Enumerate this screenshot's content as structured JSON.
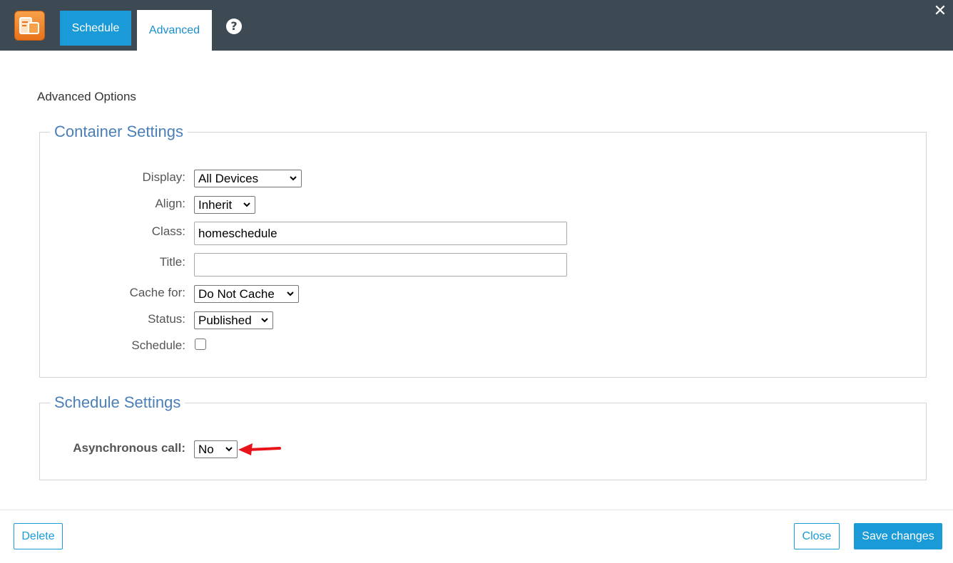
{
  "tabs": {
    "schedule": "Schedule",
    "advanced": "Advanced"
  },
  "icons": {
    "logo": "module-logo-icon",
    "help": "question-circle-icon",
    "close": "close-icon",
    "annotation": "red-arrow-icon"
  },
  "help_glyph": "?",
  "close_glyph": "✕",
  "heading": "Advanced Options",
  "container_settings": {
    "legend": "Container Settings",
    "display": {
      "label": "Display:",
      "value": "All Devices"
    },
    "align": {
      "label": "Align:",
      "value": "Inherit"
    },
    "class": {
      "label": "Class:",
      "value": "homeschedule"
    },
    "title": {
      "label": "Title:",
      "value": ""
    },
    "cache": {
      "label": "Cache for:",
      "value": "Do Not Cache"
    },
    "status": {
      "label": "Status:",
      "value": "Published"
    },
    "schedule": {
      "label": "Schedule:",
      "checked": false
    }
  },
  "schedule_settings": {
    "legend": "Schedule Settings",
    "async": {
      "label": "Asynchronous call:",
      "value": "No"
    }
  },
  "footer": {
    "delete": "Delete",
    "close": "Close",
    "save": "Save changes"
  },
  "colors": {
    "topbar": "#3d4953",
    "accent": "#1a9ad6",
    "legend": "#4a7fb8",
    "arrow": "#e8141a"
  }
}
